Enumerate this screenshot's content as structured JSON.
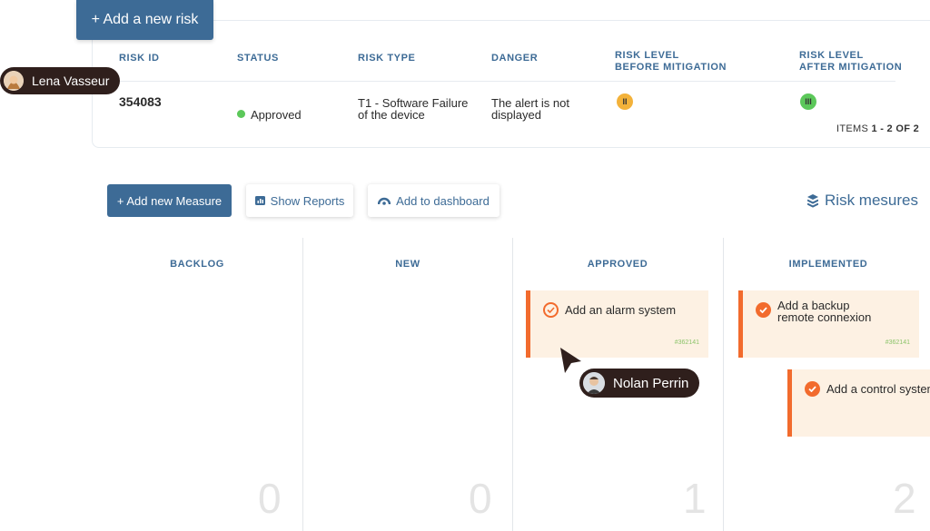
{
  "risk_table": {
    "add_button": "+ Add a new risk",
    "columns": [
      "RISK ID",
      "STATUS",
      "RISK TYPE",
      "DANGER",
      "RISK LEVEL\nBEFORE MITIGATION",
      "RISK LEVEL\nAFTER MITIGATION"
    ],
    "row": {
      "risk_id": "354083",
      "status": "Approved",
      "risk_type": "T1 - Software Failure\nof the device",
      "danger": "The alert is not\ndisplayed",
      "level_before": "II",
      "level_after": "III"
    },
    "items_label": "ITEMS",
    "items_range": "1 - 2 OF 2"
  },
  "users": {
    "lena": "Lena Vasseur",
    "nolan": "Nolan Perrin"
  },
  "toolbar": {
    "add_measure": "+ Add new Measure",
    "show_reports": "Show Reports",
    "add_dashboard": "Add to dashboard",
    "risk_mesures": "Risk mesures"
  },
  "kanban": {
    "columns": [
      {
        "title": "BACKLOG",
        "count": "0"
      },
      {
        "title": "NEW",
        "count": "0"
      },
      {
        "title": "APPROVED",
        "count": "1"
      },
      {
        "title": "IMPLEMENTED",
        "count": "2"
      }
    ],
    "cards": [
      {
        "title": "Add an alarm system",
        "ref": "#362141"
      },
      {
        "title": "Add a backup\nremote connexion",
        "ref": "#362141"
      },
      {
        "title": "Add a control system",
        "ref": ""
      }
    ]
  },
  "colors": {
    "primary": "#3d6b96",
    "accent_orange": "#f26b2d",
    "card_bg": "#fdf1e3",
    "status_green": "#5cc85a",
    "level_ii": "#f3b23a",
    "level_iii": "#5cc85a"
  },
  "icons": {
    "reports": "bar-chart-icon",
    "dashboard": "dashboard-gauge-icon",
    "mesures": "layers-stack-icon",
    "card_check": "check-circle-icon"
  }
}
